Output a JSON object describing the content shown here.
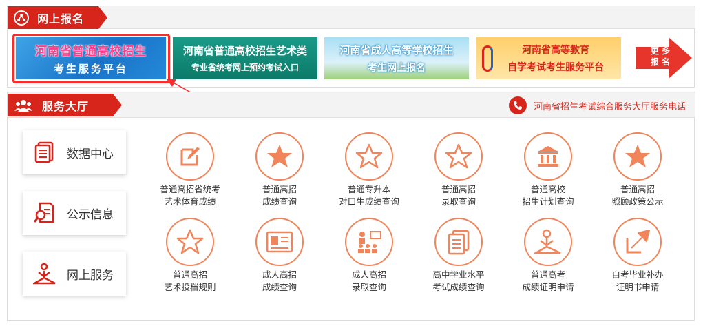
{
  "online_reg": {
    "title": "网上报名",
    "banners": [
      {
        "line1": "河南省普通高校招生",
        "line2": "考生服务平台"
      },
      {
        "line1": "河南省普通高校招生艺术类",
        "line2": "专业省统考网上预约考试入口"
      },
      {
        "line1": "河南省成人高等学校招生",
        "line2": "考生网上报名"
      },
      {
        "line1": "河南省高等教育",
        "line2": "自学考试考生服务平台"
      }
    ],
    "more": {
      "line1": "更 多",
      "line2": "报 名"
    }
  },
  "service_hall": {
    "title": "服务大厅",
    "phone_text": "河南省招生考试综合服务大厅服务电话",
    "side_buttons": [
      "数据中心",
      "公示信息",
      "网上服务"
    ],
    "services": [
      {
        "l1": "普通高招省统考",
        "l2": "艺术体育成绩",
        "icon": "edit-icon"
      },
      {
        "l1": "普通高招",
        "l2": "成绩查询",
        "icon": "star-filled-icon"
      },
      {
        "l1": "普通专升本",
        "l2": "对口生成绩查询",
        "icon": "star-outline-icon"
      },
      {
        "l1": "普通高招",
        "l2": "录取查询",
        "icon": "star-outline-icon"
      },
      {
        "l1": "普通高校",
        "l2": "招生计划查询",
        "icon": "building-icon"
      },
      {
        "l1": "普通高招",
        "l2": "照顾政策公示",
        "icon": "star-filled-icon"
      },
      {
        "l1": "普通高招",
        "l2": "艺术投档规则",
        "icon": "star-outline-icon"
      },
      {
        "l1": "成人高招",
        "l2": "成绩查询",
        "icon": "id-card-icon"
      },
      {
        "l1": "成人高招",
        "l2": "录取查询",
        "icon": "meeting-icon"
      },
      {
        "l1": "高中学业水平",
        "l2": "考试成绩查询",
        "icon": "document-stack-icon"
      },
      {
        "l1": "普通高考",
        "l2": "成绩证明申请",
        "icon": "reading-person-icon"
      },
      {
        "l1": "自考毕业补办",
        "l2": "证明书申请",
        "icon": "export-arrow-icon"
      }
    ]
  },
  "colors": {
    "brand_red": "#d8251b",
    "icon_orange": "#f0845a",
    "highlight_red": "#ff2a2a"
  }
}
